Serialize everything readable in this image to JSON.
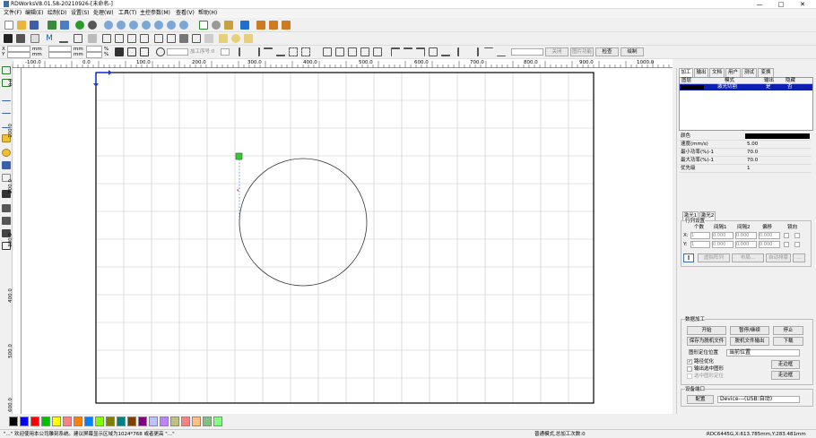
{
  "window": {
    "title": "RDWorksV8.01.58-20210926-[未命名-]",
    "controls": [
      "—",
      "□",
      "✕"
    ]
  },
  "menu": [
    "文件(F)",
    "编辑(E)",
    "绘制(D)",
    "设置(S)",
    "处理(W)",
    "工具(T)",
    "主控参数(M)",
    "查看(V)",
    "帮助(H)"
  ],
  "toolbar2": {
    "unit": "mm",
    "unit2": "mm",
    "percent": "%",
    "percent2": "%",
    "process_order": "加工序号:0",
    "zoom_value": "",
    "btn_lens_off": "关闭",
    "btn_lens_on": "图片功能",
    "btn_check": "检查",
    "btn_draw": "绘制"
  },
  "rulers": {
    "top": [
      "-100.0",
      "0.0",
      "100.0",
      "200.0",
      "300.0",
      "400.0",
      "500.0",
      "600.0",
      "700.0",
      "800.0",
      "900.0",
      "1000.0"
    ],
    "left": [
      "0.0",
      "100.0",
      "200.0",
      "300.0",
      "400.0",
      "500.0",
      "600.0"
    ]
  },
  "panel": {
    "tabs": [
      "加工",
      "输出",
      "文档",
      "用户",
      "测试",
      "变换"
    ],
    "layer_headers": [
      "图层",
      "模式",
      "输出",
      "隐藏"
    ],
    "layer_row": {
      "mode": "激光切割",
      "output": "是",
      "hidden": "否",
      "color": "#000000"
    },
    "props": [
      {
        "label": "颜色",
        "value": ""
      },
      {
        "label": "速度(mm/s)",
        "value": "5.00"
      },
      {
        "label": "最小功率(%)-1",
        "value": "70.0"
      },
      {
        "label": "最大功率(%)-1",
        "value": "70.0"
      },
      {
        "label": "优先级",
        "value": "1"
      }
    ],
    "laser_tabs": [
      "激光1",
      "激光2"
    ],
    "array_title": "行列设置",
    "array_headers": [
      "个数",
      "间隔1",
      "间隔2",
      "偏移",
      "镜向"
    ],
    "array_rows": [
      {
        "label": "X:",
        "count": "1",
        "v1": "0.000",
        "v2": "0.000",
        "v3": "0.000"
      },
      {
        "label": "Y:",
        "count": "1",
        "v1": "0.000",
        "v2": "0.000",
        "v3": "0.000"
      }
    ],
    "array_buttons": [
      "虚拟阵列",
      "布局...",
      "自动排版",
      "..."
    ],
    "data_title": "数据加工",
    "buttons": [
      [
        "开始",
        "暂停/继续",
        "停止"
      ],
      [
        "保存为脱机文件",
        "脱机文件输出",
        "下载"
      ]
    ],
    "position_label": "图形定位位置",
    "position_value": "当前位置",
    "checks": [
      "路径优化",
      "输出选中图形",
      "选中图形定位"
    ],
    "side_buttons": [
      "走边框",
      "走边框"
    ],
    "port_title": "设备端口",
    "port_button": "配置",
    "port_value": "Device---(USB:自动)"
  },
  "palette": [
    "#000000",
    "#0000ff",
    "#ff0000",
    "#00c000",
    "#ffff00",
    "#ff8080",
    "#ff8000",
    "#0080ff",
    "#80ff00",
    "#808000",
    "#008080",
    "#804000",
    "#800080",
    "#c0c0ff",
    "#c080ff",
    "#c0c080",
    "#ff8080",
    "#ffc080",
    "#80c080",
    "#80ff80"
  ],
  "status": {
    "welcome": "\"...\" 欢迎使用本公司雕刻系统。建议屏幕显示区域为1024*768 或者更高 \"...\"",
    "mode": "普通模式,总加工次数:0",
    "coords": "RDC6445G,X:613.785mm,Y:283.481mm"
  }
}
